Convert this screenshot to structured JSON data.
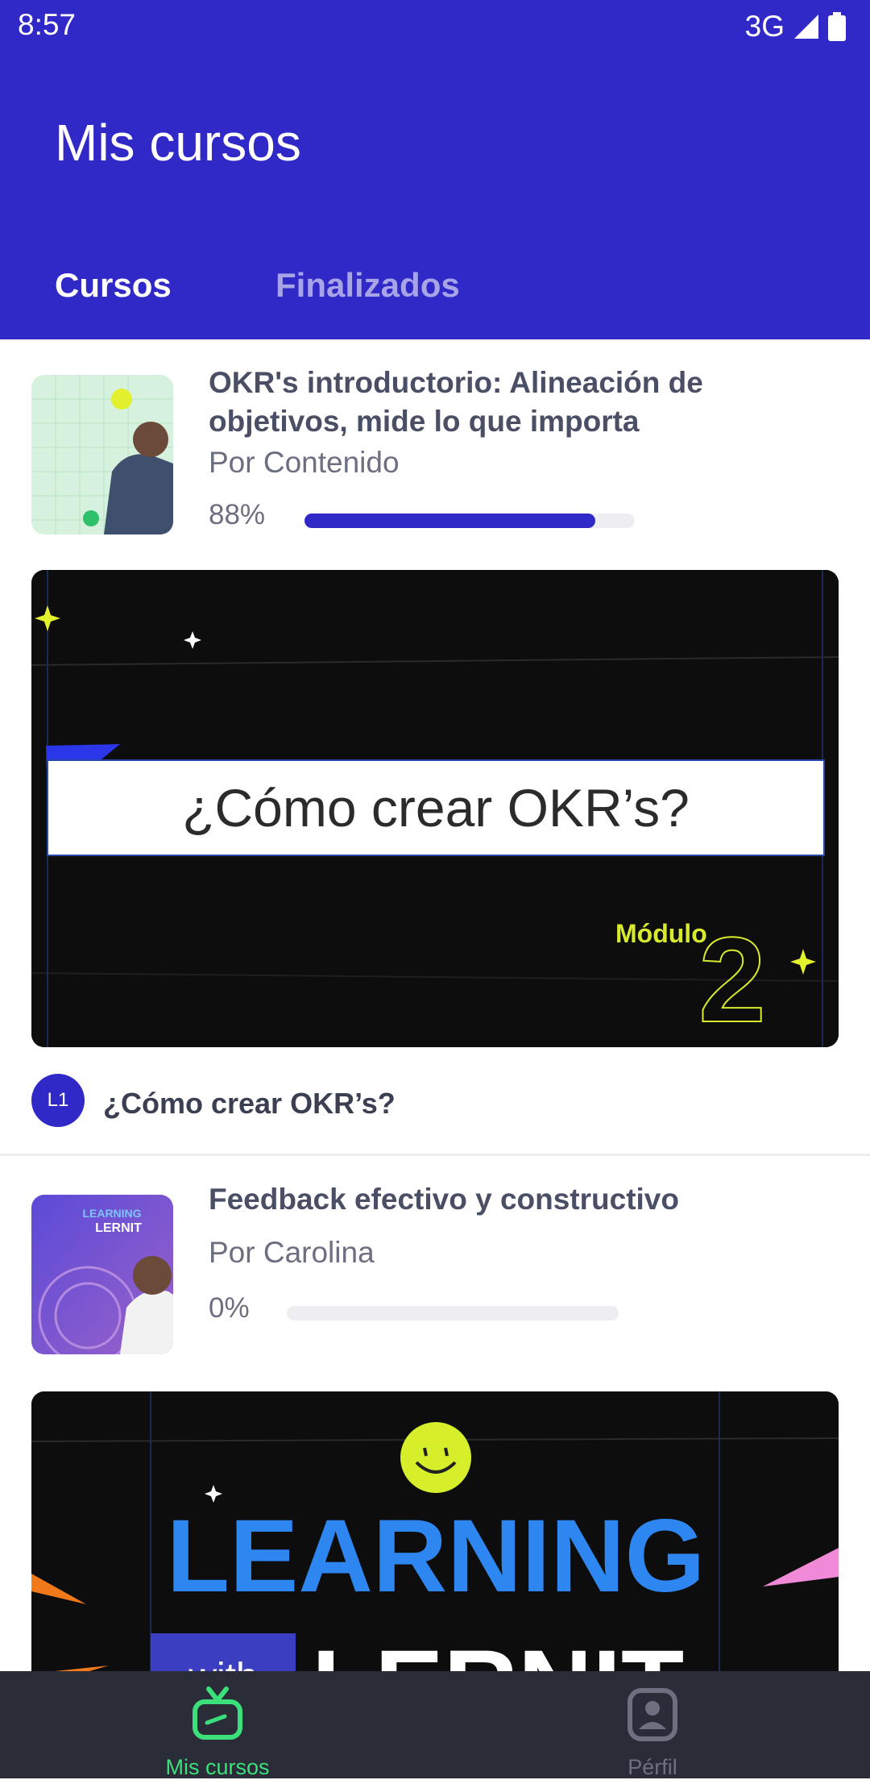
{
  "status_bar": {
    "time": "8:57",
    "network": "3G"
  },
  "header": {
    "title": "Mis cursos"
  },
  "tabs": [
    {
      "label": "Cursos",
      "active": true
    },
    {
      "label": "Finalizados",
      "active": false
    }
  ],
  "courses": [
    {
      "title": "OKR's introductorio: Alineación de objetivos, mide lo que importa",
      "author": "Por Contenido",
      "progress_label": "88%",
      "progress": 0.88,
      "banner_heading": "¿Cómo crear OKR’s?",
      "banner_module_label": "Módulo",
      "banner_module_number": "2",
      "lesson_badge": "L1",
      "lesson_title": "¿Cómo crear OKR’s?"
    },
    {
      "title": "Feedback efectivo y constructivo",
      "author": "Por Carolina",
      "progress_label": "0%",
      "progress": 0.0,
      "thumb_text_top": "LEARNING",
      "thumb_text_brand": "LERNIT",
      "banner_word_1": "LEARNING",
      "banner_word_2": "with",
      "banner_word_3": "LERNIT"
    }
  ],
  "bottom_nav": [
    {
      "label": "Mis cursos",
      "active": true,
      "icon": "tv-icon"
    },
    {
      "label": "Pérfil",
      "active": false,
      "icon": "profile-icon"
    }
  ],
  "colors": {
    "primary": "#3128c8",
    "nav_active": "#3be07a",
    "nav_inactive": "#6e7080",
    "nav_background": "#2a2c38"
  }
}
